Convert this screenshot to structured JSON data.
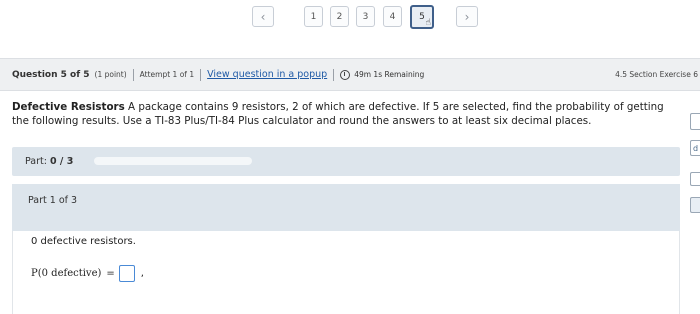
{
  "pager": {
    "prev_icon": "chevron-left-icon",
    "pages": [
      "1",
      "2",
      "3",
      "4",
      "5"
    ],
    "current_page": "5",
    "next_icon": "chevron-right-icon"
  },
  "header": {
    "question_label": "Question 5 of 5",
    "points": "(1 point)",
    "attempt": "Attempt 1 of 1",
    "popup_link": "View question in a popup",
    "timer_icon": "timer-icon",
    "timer": "49m 1s Remaining",
    "section": "4.5 Section Exercise 6"
  },
  "problem": {
    "title": "Defective Resistors",
    "text": "A package contains 9 resistors, 2 of which are defective. If 5 are selected, find the probability of getting the following results. Use a TI-83 Plus/TI-84 Plus calculator and round the answers to at least six decimal places."
  },
  "progress": {
    "label": "Part:",
    "value": "0 / 3",
    "fraction": 0
  },
  "part": {
    "title": "Part 1 of 3",
    "subtitle": "0 defective resistors.",
    "expression": "P(0 defective)",
    "equals": "=",
    "answer_value": "",
    "trailing": ","
  },
  "side_tools": [
    "",
    "d",
    ""
  ]
}
